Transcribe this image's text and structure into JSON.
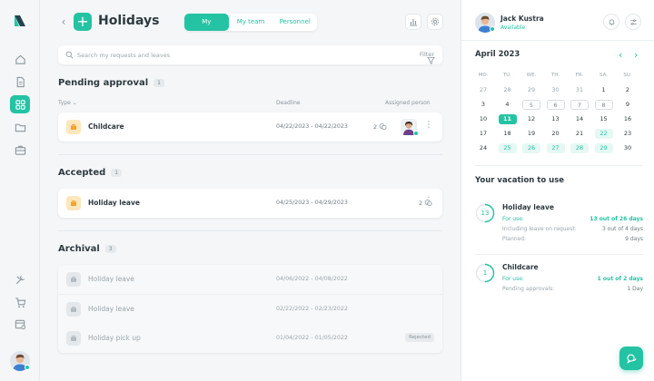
{
  "header": {
    "title": "Holidays",
    "back_label": "‹",
    "add_label": "+"
  },
  "tabs": [
    {
      "label": "My",
      "active": true
    },
    {
      "label": "My team",
      "active": false
    },
    {
      "label": "Personnel",
      "active": false
    }
  ],
  "search": {
    "placeholder": "Search my requests and leaves",
    "filter_label": "Filter"
  },
  "columns": {
    "type": "Type",
    "deadline": "Deadline",
    "assigned": "Assigned person"
  },
  "pending": {
    "title": "Pending approval",
    "count": "1",
    "rows": [
      {
        "name": "Childcare",
        "dates": "04/22/2023 - 04/22/2023",
        "comments": "2"
      }
    ]
  },
  "accepted": {
    "title": "Accepted",
    "count": "1",
    "rows": [
      {
        "name": "Holiday leave",
        "dates": "04/25/2023 - 04/29/2023",
        "comments": "2"
      }
    ]
  },
  "archival": {
    "title": "Archival",
    "count": "3",
    "rows": [
      {
        "name": "Holiday leave",
        "dates": "04/06/2022 - 04/08/2022"
      },
      {
        "name": "Holiday leave",
        "dates": "02/22/2022 - 02/23/2022"
      },
      {
        "name": "Holiday pick up",
        "dates": "01/04/2022 - 01/05/2022",
        "badge": "Rejected"
      }
    ]
  },
  "user": {
    "name": "Jack Kustra",
    "status": "Available"
  },
  "calendar": {
    "month": "April 2023",
    "weekdays": [
      "MO.",
      "TU.",
      "WE.",
      "TH.",
      "FR.",
      "SA.",
      "SU."
    ],
    "weeks": [
      [
        "27",
        "28",
        "29",
        "30",
        "31",
        "1",
        "2"
      ],
      [
        "3",
        "4",
        "5",
        "6",
        "7",
        "8",
        "9"
      ],
      [
        "10",
        "11",
        "12",
        "13",
        "14",
        "15",
        "16"
      ],
      [
        "17",
        "18",
        "19",
        "20",
        "21",
        "22",
        "23"
      ],
      [
        "24",
        "25",
        "26",
        "27",
        "28",
        "29",
        "30"
      ]
    ],
    "today": "11",
    "vacation_days": [
      "22",
      "25",
      "26",
      "27",
      "28",
      "29"
    ],
    "boxed_days": [
      "5",
      "6",
      "7",
      "8"
    ]
  },
  "vacation": {
    "title": "Your vacation to use",
    "items": [
      {
        "badge": "13",
        "name": "Holiday leave",
        "fill": 0.5,
        "lines": [
          {
            "k": "For use:",
            "v": "13 out of 26 days",
            "hl": true
          },
          {
            "k": "Including leave on request:",
            "v": "3 out of 4 days",
            "hl": false
          },
          {
            "k": "Planned:",
            "v": "9 days",
            "hl": false
          }
        ]
      },
      {
        "badge": "1",
        "name": "Childcare",
        "fill": 0.5,
        "lines": [
          {
            "k": "For use:",
            "v": "1 out of 2 days",
            "hl": true
          },
          {
            "k": "Pending approvals:",
            "v": "1 Day",
            "hl": false
          }
        ]
      }
    ]
  },
  "colors": {
    "accent": "#24c3a3",
    "leave_icon_bg": "#fde6bc"
  }
}
